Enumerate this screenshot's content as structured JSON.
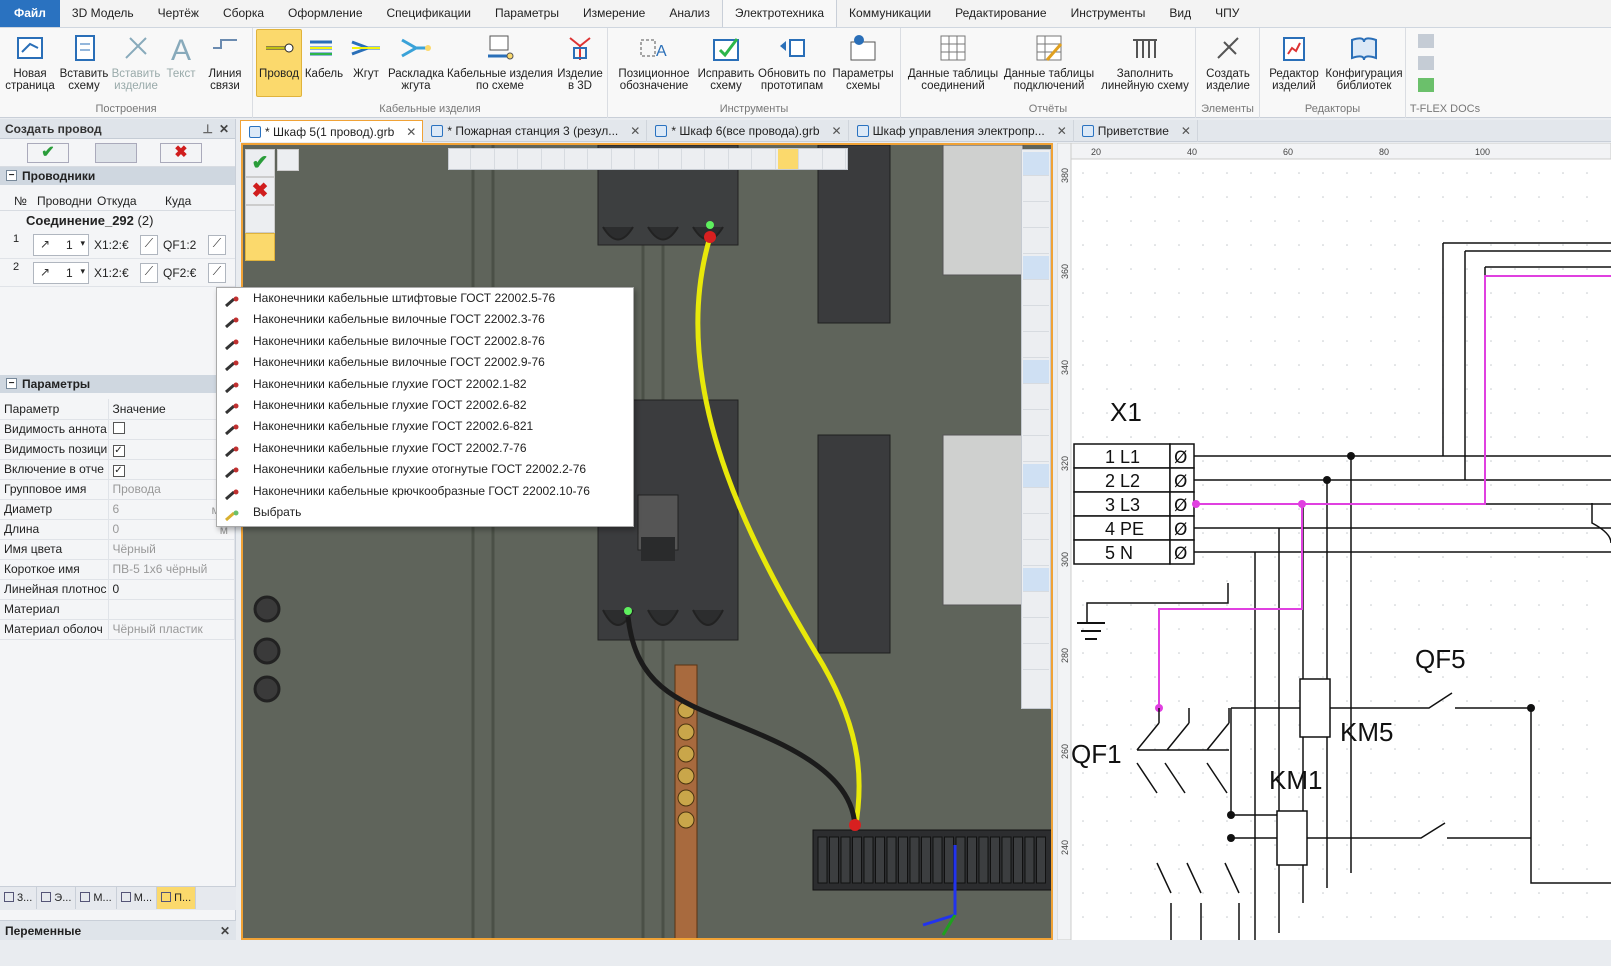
{
  "menubar": {
    "tabs": [
      "Файл",
      "3D Модель",
      "Чертёж",
      "Сборка",
      "Оформление",
      "Спецификации",
      "Параметры",
      "Измерение",
      "Анализ",
      "Электротехника",
      "Коммуникации",
      "Редактирование",
      "Инструменты",
      "Вид",
      "ЧПУ"
    ],
    "active": "Электротехника"
  },
  "ribbon": {
    "groups": [
      {
        "label": "Построения",
        "buttons": [
          "Новая страница",
          "Вставить схему",
          "Вставить изделие",
          "Текст",
          "Линия связи"
        ]
      },
      {
        "label": "Кабельные изделия",
        "buttons": [
          "Провод",
          "Кабель",
          "Жгут",
          "Раскладка жгута",
          "Кабельные изделия по схеме",
          "Изделие в 3D"
        ]
      },
      {
        "label": "Инструменты",
        "buttons": [
          "Позиционное обозначение",
          "Исправить схему",
          "Обновить по прототипам",
          "Параметры схемы"
        ]
      },
      {
        "label": "Отчёты",
        "buttons": [
          "Данные таблицы соединений",
          "Данные таблицы подключений",
          "Заполнить линейную схему"
        ]
      },
      {
        "label": "Элементы",
        "buttons": [
          "Создать изделие"
        ]
      },
      {
        "label": "Редакторы",
        "buttons": [
          "Редактор изделий",
          "Конфигурация библиотек"
        ]
      },
      {
        "label": "T-FLEX DOCs",
        "buttons": []
      }
    ]
  },
  "leftpanel": {
    "title": "Создать провод",
    "conductors_section": "Проводники",
    "conductor_headers": [
      "№",
      "Проводни",
      "Откуда",
      "Куда"
    ],
    "connection": "Соединение_292",
    "connection_count": "(2)",
    "rows": [
      {
        "n": "1",
        "count": "1",
        "from": "X1:2:€",
        "to": "QF1:2"
      },
      {
        "n": "2",
        "count": "1",
        "from": "X1:2:€",
        "to": "QF2:€"
      }
    ],
    "params_section": "Параметры",
    "param_headers": [
      "Параметр",
      "Значение"
    ],
    "params": [
      {
        "name": "Видимость аннота",
        "value": "",
        "check": false
      },
      {
        "name": "Видимость позици",
        "value": "",
        "check": true
      },
      {
        "name": "Включение в отче",
        "value": "",
        "check": true
      },
      {
        "name": "Групповое имя",
        "value": "Провода",
        "unit": ""
      },
      {
        "name": "Диаметр",
        "value": "6",
        "unit": "мм"
      },
      {
        "name": "Длина",
        "value": "0",
        "unit": "м"
      },
      {
        "name": "Имя цвета",
        "value": "Чёрный",
        "unit": ""
      },
      {
        "name": "Короткое имя",
        "value": "ПВ-5 1х6 чёрный",
        "unit": ""
      },
      {
        "name": "Линейная плотнос",
        "value": "0",
        "unit": ""
      },
      {
        "name": "Материал",
        "value": "",
        "unit": ""
      },
      {
        "name": "Материал оболоч",
        "value": "Чёрный пластик",
        "unit": ""
      }
    ]
  },
  "bottomtabs": [
    "3...",
    "Э...",
    "М...",
    "М...",
    "П..."
  ],
  "varpanel": "Переменные",
  "doctabs": [
    {
      "label": "* Шкаф 5(1 провод).grb",
      "active": true
    },
    {
      "label": "* Пожарная станция 3 (резул...",
      "active": false
    },
    {
      "label": "* Шкаф 6(все провода).grb",
      "active": false
    },
    {
      "label": "Шкаф управления электропр...",
      "active": false
    },
    {
      "label": "Приветствие",
      "active": false
    }
  ],
  "contextmenu": [
    "Наконечники кабельные штифтовые ГОСТ 22002.5-76",
    "Наконечники кабельные вилочные ГОСТ 22002.3-76",
    "Наконечники кабельные вилочные ГОСТ 22002.8-76",
    "Наконечники кабельные вилочные ГОСТ 22002.9-76",
    "Наконечники кабельные глухие ГОСТ 22002.1-82",
    "Наконечники кабельные глухие ГОСТ 22002.6-82",
    "Наконечники кабельные глухие ГОСТ 22002.6-821",
    "Наконечники кабельные глухие ГОСТ 22002.7-76",
    "Наконечники кабельные глухие отогнутые ГОСТ 22002.2-76",
    "Наконечники кабельные крючкообразные ГОСТ 22002.10-76",
    "Выбрать"
  ],
  "schematic": {
    "ruler_top": [
      "20",
      "40",
      "60",
      "80",
      "100"
    ],
    "ruler_left": [
      "380",
      "360",
      "340",
      "320",
      "300",
      "280",
      "260",
      "240"
    ],
    "terminal_block": "X1",
    "terminals": [
      "1 L1",
      "2 L2",
      "3 L3",
      "4 PE",
      "5 N"
    ],
    "labels": {
      "qf1": "QF1",
      "qf5": "QF5",
      "km5": "KM5",
      "km1": "KM1"
    }
  },
  "colors": {
    "accent": "#2a72c0",
    "highlight": "#f0a236",
    "wire_yellow": "#f4f40a",
    "wire_magenta": "#e040e0"
  }
}
